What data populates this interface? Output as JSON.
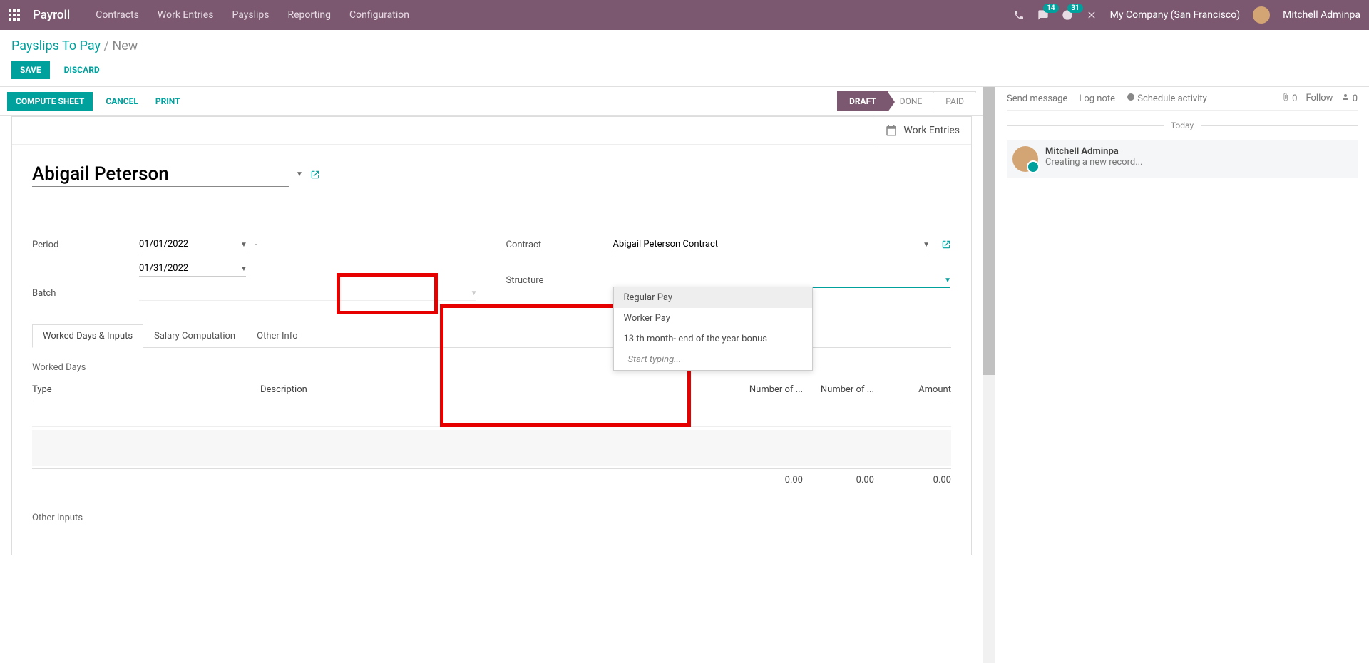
{
  "nav": {
    "brand": "Payroll",
    "menu": [
      "Contracts",
      "Work Entries",
      "Payslips",
      "Reporting",
      "Configuration"
    ],
    "chat_badge": "14",
    "activity_badge": "31",
    "company": "My Company (San Francisco)",
    "user": "Mitchell Adminpa"
  },
  "breadcrumb": {
    "root": "Payslips To Pay",
    "current": "New"
  },
  "buttons": {
    "save": "SAVE",
    "discard": "DISCARD",
    "compute": "COMPUTE SHEET",
    "cancel": "CANCEL",
    "print": "PRINT"
  },
  "stages": {
    "draft": "DRAFT",
    "done": "DONE",
    "paid": "PAID"
  },
  "stat": {
    "work_entries": "Work Entries"
  },
  "form": {
    "employee": "Abigail Peterson",
    "period_label": "Period",
    "date_from": "01/01/2022",
    "date_to": "01/31/2022",
    "batch_label": "Batch",
    "batch_value": "",
    "contract_label": "Contract",
    "contract_value": "Abigail Peterson Contract",
    "structure_label": "Structure",
    "structure_value": "",
    "structure_options": [
      "Regular Pay",
      "Worker Pay",
      "13 th month- end of the year bonus"
    ],
    "dropdown_footer": "Start typing..."
  },
  "tabs": {
    "t1": "Worked Days & Inputs",
    "t2": "Salary Computation",
    "t3": "Other Info"
  },
  "worked_days": {
    "title": "Worked Days",
    "cols": {
      "type": "Type",
      "desc": "Description",
      "nd": "Number of ...",
      "nh": "Number of ...",
      "amt": "Amount"
    },
    "totals": {
      "nd": "0.00",
      "nh": "0.00",
      "amt": "0.00"
    }
  },
  "other_inputs_title": "Other Inputs",
  "chatter": {
    "send": "Send message",
    "log": "Log note",
    "schedule": "Schedule activity",
    "attach_count": "0",
    "follow": "Follow",
    "followers": "0",
    "today": "Today",
    "msg_author": "Mitchell Adminpa",
    "msg_body": "Creating a new record..."
  }
}
